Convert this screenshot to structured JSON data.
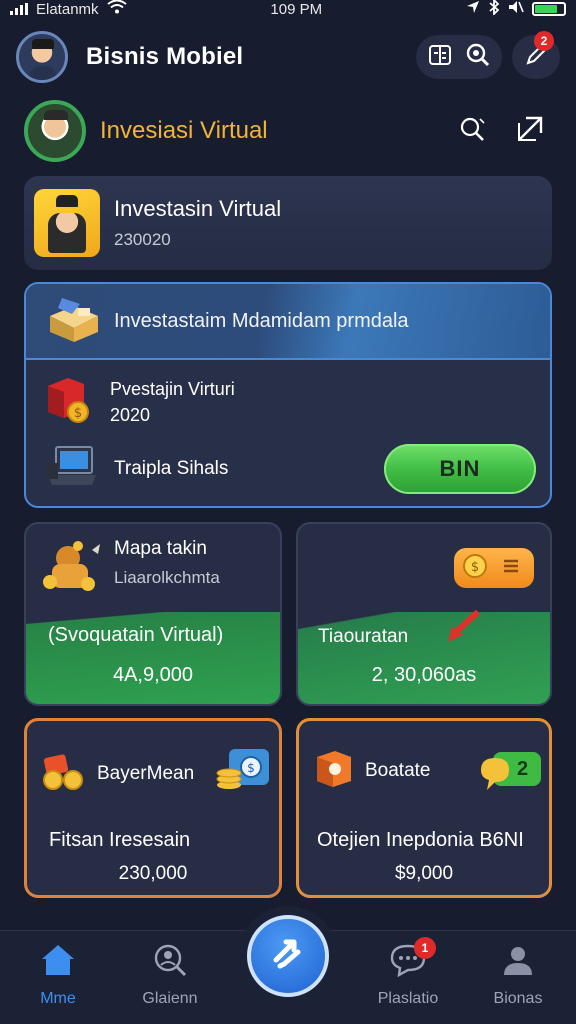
{
  "status_bar": {
    "carrier": "Elatanmk",
    "time": "109 PM"
  },
  "header": {
    "title": "Bisnis Mobiel",
    "notification_count": "2"
  },
  "subheader": {
    "title": "Invesiasi Virtual"
  },
  "virtual_card": {
    "title": "Investasin Virtual",
    "value": "230020"
  },
  "invest_panel": {
    "banner_title": "Investastaim Mdamidam prmdala",
    "row1_line1": "Pvestajin Virturi",
    "row1_line2": "2020",
    "row2_label": "Traipla Sihals",
    "action_button": "BIN"
  },
  "tiles": [
    {
      "title": "Mapa takin",
      "subtitle": "Liaarolkchmta",
      "label": "(Svoquatain Virtual)",
      "value": "4А,9,000"
    },
    {
      "label": "Tiaouratan",
      "value": "2, 30,060аs"
    },
    {
      "title": "BayerMean",
      "label": "Fitsan Iresesain",
      "value": "230,000"
    },
    {
      "title": "Boatate",
      "badge": "2",
      "label": "Otejien Inepdonia B6NI",
      "value": "$9,000"
    }
  ],
  "bottom_nav": {
    "items": [
      {
        "label": "Mme"
      },
      {
        "label": "Glaienn"
      },
      {
        "label": "Plaslatio",
        "badge": "1"
      },
      {
        "label": "Bionas"
      }
    ]
  },
  "colors": {
    "background": "#171c2e",
    "accent_gold": "#f0b43a",
    "accent_blue": "#3e8ef0",
    "accent_green": "#3fbb43",
    "badge_red": "#e02a2a"
  }
}
